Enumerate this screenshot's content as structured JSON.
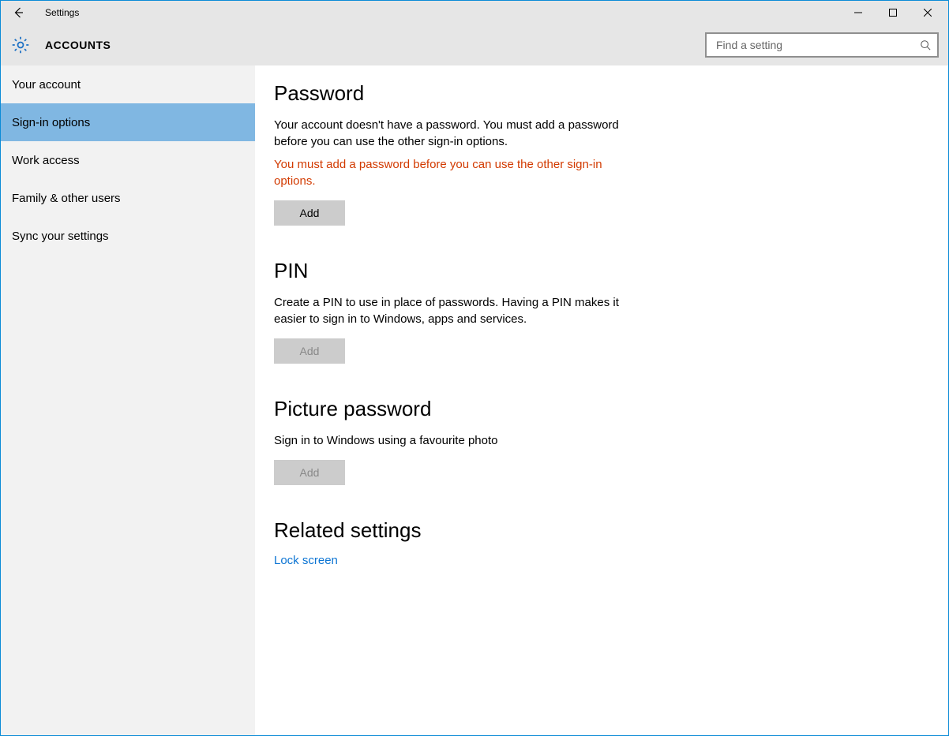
{
  "window": {
    "title": "Settings"
  },
  "header": {
    "category": "ACCOUNTS"
  },
  "search": {
    "placeholder": "Find a setting"
  },
  "sidebar": {
    "items": [
      {
        "label": "Your account"
      },
      {
        "label": "Sign-in options"
      },
      {
        "label": "Work access"
      },
      {
        "label": "Family & other users"
      },
      {
        "label": "Sync your settings"
      }
    ],
    "activeIndex": 1
  },
  "sections": {
    "password": {
      "title": "Password",
      "desc": "Your account doesn't have a password. You must add a password before you can use the other sign-in options.",
      "warning": "You must add a password before you can use the other sign-in options.",
      "button": "Add"
    },
    "pin": {
      "title": "PIN",
      "desc": "Create a PIN to use in place of passwords. Having a PIN makes it easier to sign in to Windows, apps and services.",
      "button": "Add"
    },
    "picture": {
      "title": "Picture password",
      "desc": "Sign in to Windows using a favourite photo",
      "button": "Add"
    },
    "related": {
      "title": "Related settings",
      "link": "Lock screen"
    }
  }
}
